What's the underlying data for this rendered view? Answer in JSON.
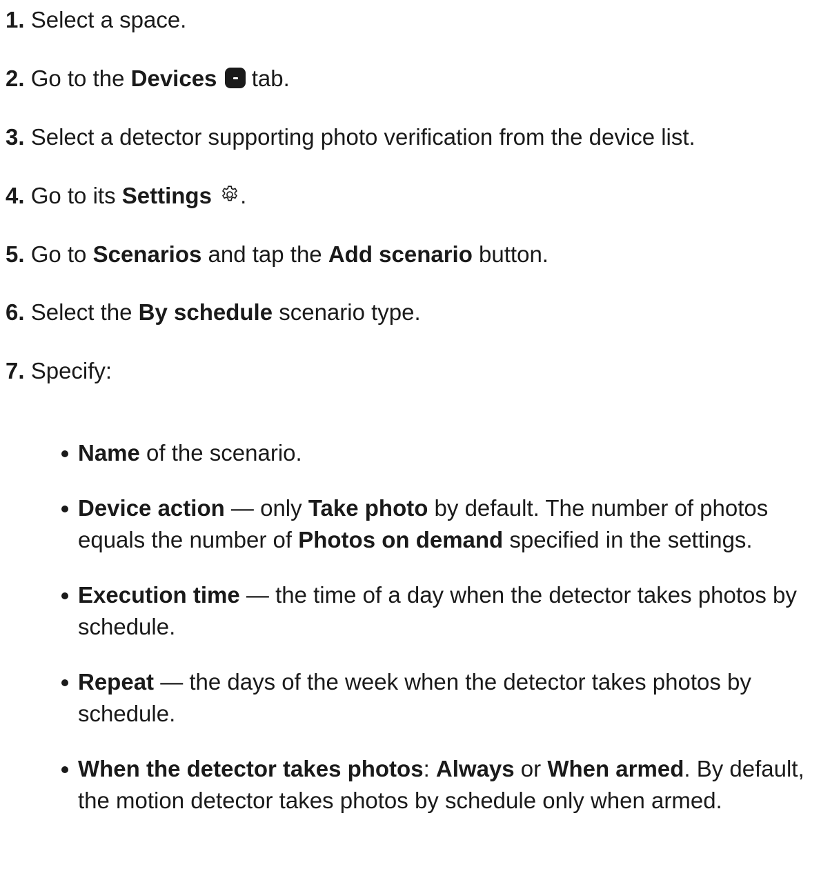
{
  "steps": [
    {
      "num": "1.",
      "t1": "Select a space."
    },
    {
      "num": "2.",
      "t1": "Go to the ",
      "b1": "Devices",
      "t2": " tab.",
      "icon": "devices-tab-icon"
    },
    {
      "num": "3.",
      "t1": "Select a detector supporting photo verification from the device list."
    },
    {
      "num": "4.",
      "t1": "Go to its ",
      "b1": "Settings",
      "t2": ".",
      "icon": "gear-icon"
    },
    {
      "num": "5.",
      "t1": "Go to ",
      "b1": "Scenarios",
      "t2": " and tap the ",
      "b2": "Add scenario",
      "t3": " button."
    },
    {
      "num": "6.",
      "t1": "Select the ",
      "b1": "By schedule",
      "t2": " scenario type."
    },
    {
      "num": "7.",
      "t1": "Specify:"
    }
  ],
  "bullets": [
    {
      "b1": "Name",
      "t1": " of the scenario."
    },
    {
      "b1": "Device action",
      "t1": " — only ",
      "b2": "Take photo",
      "t2": " by default. The number of photos equals the number of ",
      "b3": "Photos on demand",
      "t3": " specified in the settings."
    },
    {
      "b1": "Execution time",
      "t1": " — the time of a day when the detector takes photos by schedule."
    },
    {
      "b1": "Repeat",
      "t1": " — the days of the week when the detector takes photos by schedule."
    },
    {
      "b1": "When the detector takes photos",
      "t1": ": ",
      "b2": "Always",
      "t2": " or ",
      "b3": "When armed",
      "t3": ". By default, the motion detector takes photos by schedule only when armed."
    }
  ]
}
